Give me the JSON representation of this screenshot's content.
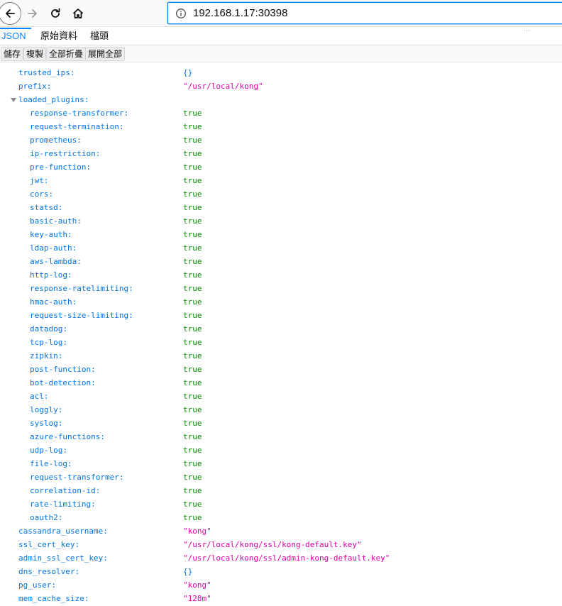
{
  "browser": {
    "url": "192.168.1.17:30398"
  },
  "viewer": {
    "tabs": [
      {
        "label": "JSON",
        "active": true
      },
      {
        "label": "原始資料",
        "active": false
      },
      {
        "label": "檔頭",
        "active": false
      }
    ],
    "actions": {
      "save": "儲存",
      "copy": "複製",
      "collapse_all": "全部折疊",
      "expand_all": "展開全部"
    }
  },
  "colors": {
    "key": "#0074e8",
    "string": "#dd00a9",
    "boolean": "#058b00",
    "accent": "#0a84ff"
  },
  "tree": {
    "top_rows": [
      {
        "key": "trusted_ips:",
        "value": "{}",
        "type": "obj"
      },
      {
        "key": "prefix:",
        "value": "\"/usr/local/kong\"",
        "type": "str"
      }
    ],
    "plugins_key": "loaded_plugins:",
    "plugins": [
      {
        "key": "response-transformer:",
        "value": "true"
      },
      {
        "key": "request-termination:",
        "value": "true"
      },
      {
        "key": "prometheus:",
        "value": "true"
      },
      {
        "key": "ip-restriction:",
        "value": "true"
      },
      {
        "key": "pre-function:",
        "value": "true"
      },
      {
        "key": "jwt:",
        "value": "true"
      },
      {
        "key": "cors:",
        "value": "true"
      },
      {
        "key": "statsd:",
        "value": "true"
      },
      {
        "key": "basic-auth:",
        "value": "true"
      },
      {
        "key": "key-auth:",
        "value": "true"
      },
      {
        "key": "ldap-auth:",
        "value": "true"
      },
      {
        "key": "aws-lambda:",
        "value": "true"
      },
      {
        "key": "http-log:",
        "value": "true"
      },
      {
        "key": "response-ratelimiting:",
        "value": "true"
      },
      {
        "key": "hmac-auth:",
        "value": "true"
      },
      {
        "key": "request-size-limiting:",
        "value": "true"
      },
      {
        "key": "datadog:",
        "value": "true"
      },
      {
        "key": "tcp-log:",
        "value": "true"
      },
      {
        "key": "zipkin:",
        "value": "true"
      },
      {
        "key": "post-function:",
        "value": "true"
      },
      {
        "key": "bot-detection:",
        "value": "true"
      },
      {
        "key": "acl:",
        "value": "true"
      },
      {
        "key": "loggly:",
        "value": "true"
      },
      {
        "key": "syslog:",
        "value": "true"
      },
      {
        "key": "azure-functions:",
        "value": "true"
      },
      {
        "key": "udp-log:",
        "value": "true"
      },
      {
        "key": "file-log:",
        "value": "true"
      },
      {
        "key": "request-transformer:",
        "value": "true"
      },
      {
        "key": "correlation-id:",
        "value": "true"
      },
      {
        "key": "rate-limiting:",
        "value": "true"
      },
      {
        "key": "oauth2:",
        "value": "true"
      }
    ],
    "bottom_rows": [
      {
        "key": "cassandra_username:",
        "value": "\"kong\"",
        "type": "str"
      },
      {
        "key": "ssl_cert_key:",
        "value": "\"/usr/local/kong/ssl/kong-default.key\"",
        "type": "str"
      },
      {
        "key": "admin_ssl_cert_key:",
        "value": "\"/usr/local/kong/ssl/admin-kong-default.key\"",
        "type": "str"
      },
      {
        "key": "dns_resolver:",
        "value": "{}",
        "type": "obj"
      },
      {
        "key": "pg_user:",
        "value": "\"kong\"",
        "type": "str"
      },
      {
        "key": "mem_cache_size:",
        "value": "\"128m\"",
        "type": "str"
      }
    ]
  }
}
